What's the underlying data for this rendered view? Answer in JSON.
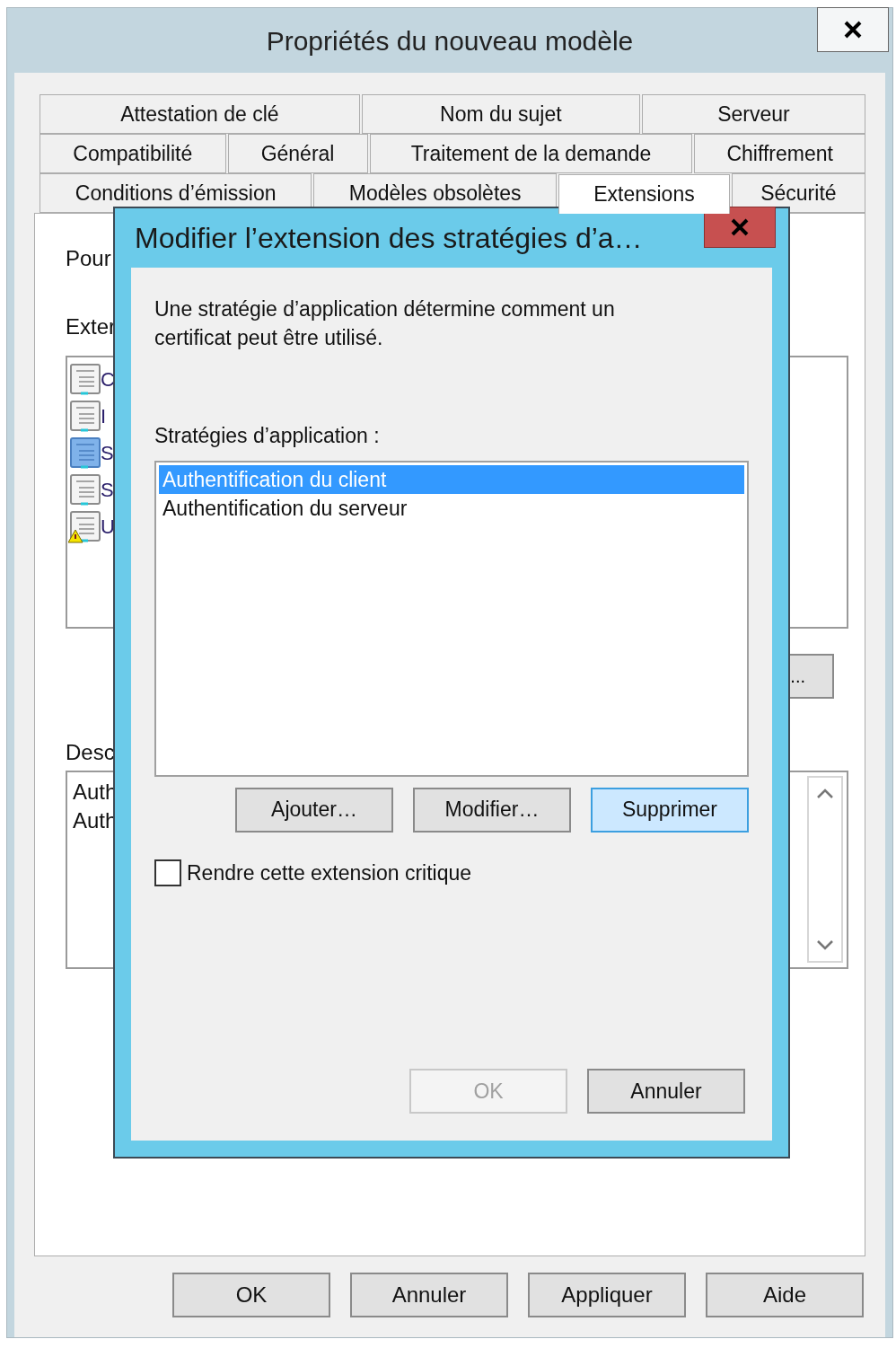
{
  "window": {
    "title": "Propriétés du nouveau modèle"
  },
  "tab_rows": [
    {
      "tabs": [
        {
          "label": "Attestation de clé",
          "selected": false
        },
        {
          "label": "Nom du sujet",
          "selected": false
        },
        {
          "label": "Serveur",
          "selected": false
        }
      ]
    },
    {
      "tabs": [
        {
          "label": "Compatibilité",
          "selected": false
        },
        {
          "label": "Général",
          "selected": false
        },
        {
          "label": "Traitement de la demande",
          "selected": false
        },
        {
          "label": "Chiffrement",
          "selected": false
        }
      ]
    },
    {
      "tabs": [
        {
          "label": "Conditions d’émission",
          "selected": false
        },
        {
          "label": "Modèles obsolètes",
          "selected": false
        },
        {
          "label": "Extensions",
          "selected": true
        },
        {
          "label": "Sécurité",
          "selected": false
        }
      ]
    }
  ],
  "panel": {
    "intro_label": "Pour",
    "extensions_label": "Exter",
    "extensions": [
      {
        "text": "C",
        "kind": "normal",
        "selected": false
      },
      {
        "text": "I",
        "kind": "normal",
        "selected": false
      },
      {
        "text": "S",
        "kind": "normal",
        "selected": true
      },
      {
        "text": "S",
        "kind": "normal",
        "selected": false
      },
      {
        "text": "U",
        "kind": "warning",
        "selected": false
      }
    ],
    "edit_button": "...",
    "description_label": "Desc",
    "description_lines": [
      "Auth",
      "Auth"
    ]
  },
  "dialog": {
    "title": "Modifier l’extension des stratégies d’a…",
    "description": "Une stratégie d’application détermine comment un certificat peut être utilisé.",
    "list_label": "Stratégies d’application :",
    "policies": [
      {
        "text": "Authentification du client",
        "selected": true
      },
      {
        "text": "Authentification du serveur",
        "selected": false
      }
    ],
    "buttons": [
      {
        "label": "Ajouter…",
        "focused": false
      },
      {
        "label": "Modifier…",
        "focused": false
      },
      {
        "label": "Supprimer",
        "focused": true
      }
    ],
    "critical": {
      "label": "Rendre cette extension critique",
      "checked": false
    },
    "footer_buttons": [
      {
        "label": "OK",
        "disabled": true
      },
      {
        "label": "Annuler",
        "disabled": false
      }
    ]
  },
  "buttons": [
    "OK",
    "Annuler",
    "Appliquer",
    "Aide"
  ]
}
